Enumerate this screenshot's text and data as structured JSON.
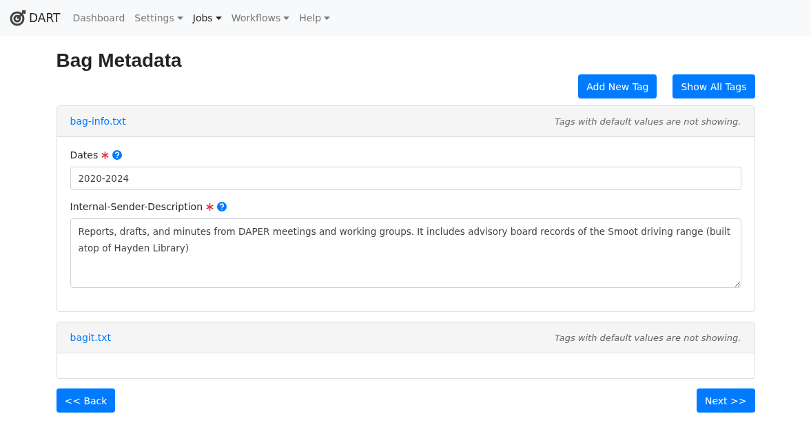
{
  "navbar": {
    "brand": "DART",
    "items": [
      {
        "label": "Dashboard",
        "selected": false,
        "dropdown": false
      },
      {
        "label": "Settings",
        "selected": false,
        "dropdown": true
      },
      {
        "label": "Jobs",
        "selected": true,
        "dropdown": true
      },
      {
        "label": "Workflows",
        "selected": false,
        "dropdown": true
      },
      {
        "label": "Help",
        "selected": false,
        "dropdown": true
      }
    ]
  },
  "page_title": "Bag Metadata",
  "actions": [
    "Add New Tag",
    "Show All Tags"
  ],
  "tag_files": [
    {
      "name": "bag-info.txt",
      "note": "Tags with default values are not showing.",
      "fields": [
        {
          "kind": "input",
          "label": "Dates",
          "required": true,
          "value": "2020-2024"
        },
        {
          "kind": "textarea",
          "label": "Internal-Sender-Description",
          "required": true,
          "value": "Reports, drafts, and minutes from DAPER meetings and working groups. It includes advisory board records of the Smoot driving range (built atop of Hayden Library)"
        }
      ]
    },
    {
      "name": "bagit.txt",
      "note": "Tags with default values are not showing."
    }
  ],
  "back_button": "<< Back",
  "next_button": "Next >>"
}
